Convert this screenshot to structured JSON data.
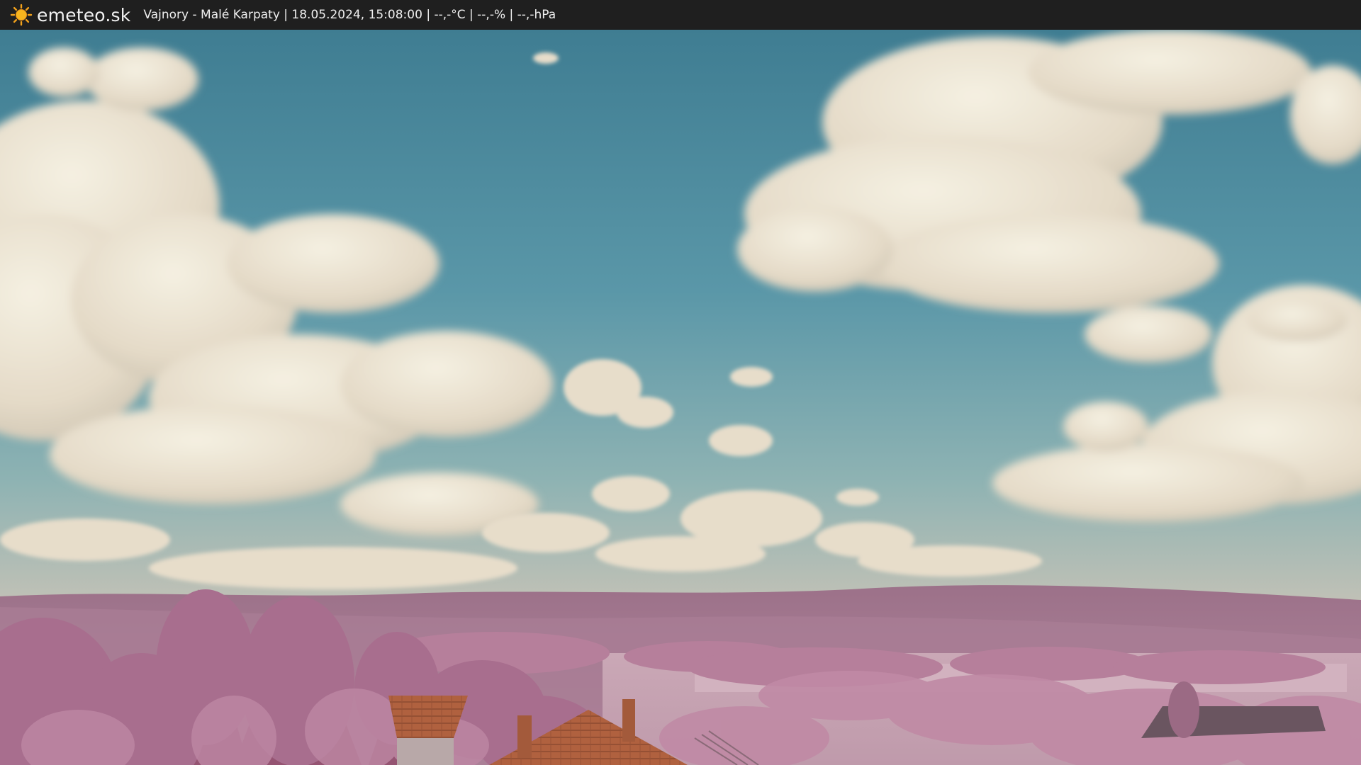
{
  "header": {
    "brand": "emeteo.sk",
    "caption": "Vajnory - Malé Karpaty | 18.05.2024, 15:08:00 | --,-°C | --,-% | --,-hPa",
    "brand_icon": "sun-icon"
  },
  "webcam": {
    "scene_icon": "webcam-image"
  },
  "colors": {
    "bar_background": "#1f1f1f",
    "sky": "#5e9aa8",
    "cloud": "#ece4d2",
    "foliage": "#a86e8e",
    "roof": "#b0613f"
  }
}
